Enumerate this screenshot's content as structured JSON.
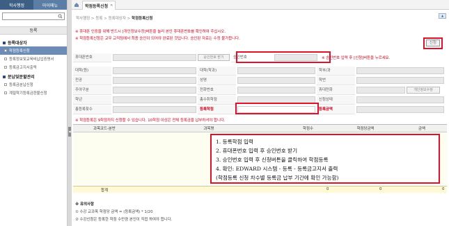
{
  "sidebar": {
    "tabs": [
      "학사행정",
      "마이메뉴"
    ],
    "title": "등록",
    "groups": [
      {
        "label": "등록대상자",
        "items": [
          "학점등록신청",
          "등록정보및교육비납입증명서",
          "등록금고지서출력"
        ]
      },
      {
        "label": "분납및분할관리",
        "items": [
          "등록금분납신청",
          "계절학기등록금환불신청"
        ]
      }
    ]
  },
  "header": {
    "tab_label": "학점등록신청",
    "breadcrumb": [
      "학사행정",
      "등록",
      "등록대상자"
    ],
    "breadcrumb_current": "학점등록신청"
  },
  "notices": {
    "line1": "※ 휴대폰 인증을 위해 반드시 [개인정보수정]버튼을 눌러 본인 휴대폰번호를 확인하여 주십시오.",
    "line2": "※ 학점등록신청은 교무 교직팀에서 최종 승인이 되어야 완료된 것입니다. 승인된 자료는 수정 불가합니다.",
    "request_button": "신청"
  },
  "form": {
    "phone_label": "휴대폰번호",
    "get_code_button": "승인번호 받기",
    "code_label": "승인번호",
    "code_message": "※ 승인번호 입력 후 [신청]버튼을 누르세요.",
    "college_label": "대학(원)",
    "department_label": "대학(학과)",
    "grade_semester_label": "학부/과",
    "major_label": "전공",
    "name_label": "성명",
    "student_no_label": "학번",
    "day_night_label": "주야구분",
    "phone2_label": "전화번호",
    "mobile_label": "휴대전화",
    "edit_info_button": "개인정보수정",
    "year_label": "학년",
    "scholarship_label": "총수취학점",
    "apply_status_label": "신청상태",
    "reg_count_label": "총등록횟수",
    "reg_credits_label": "등록학점",
    "reg_amount_label": "등록금액"
  },
  "warning": "※ 학점등록은 9학점까지 신청할 수 있습니다. 10학점 이상은 전체 등록금을 납부하셔야 합니다.",
  "grid": {
    "columns": [
      "과목코드-분반",
      "과목명",
      "학점수",
      "학점당금액",
      "금액"
    ],
    "total_label": "합계",
    "total_credits": "0",
    "total_per_credit": "0",
    "total_amount": "0"
  },
  "instructions": [
    "1. 등록학점 입력",
    "2. 휴대폰번호 입력 후 승인번호 받기",
    "3. 승인번호 입력 후 신청버튼을 클릭하여 학점등록",
    "4. 확인: EDWARD 시스템 - 등록 - 등록금고지서 출력",
    "(학점등록 신청 차수별 등록금 납부 기간에 확인 가능함)"
  ],
  "notes": {
    "title": "※ 유의사항",
    "items": [
      "① 수강 교과목 학점당 금액 = (등록금액) * 1/20",
      "② 수강신청은 등록한 학점 수만큼 본인이 직접 하여야 합니다."
    ]
  },
  "colors": {
    "accent_red": "#e0102a",
    "nav_blue": "#5a7ea6",
    "selected_blue": "#6b8cb7"
  }
}
